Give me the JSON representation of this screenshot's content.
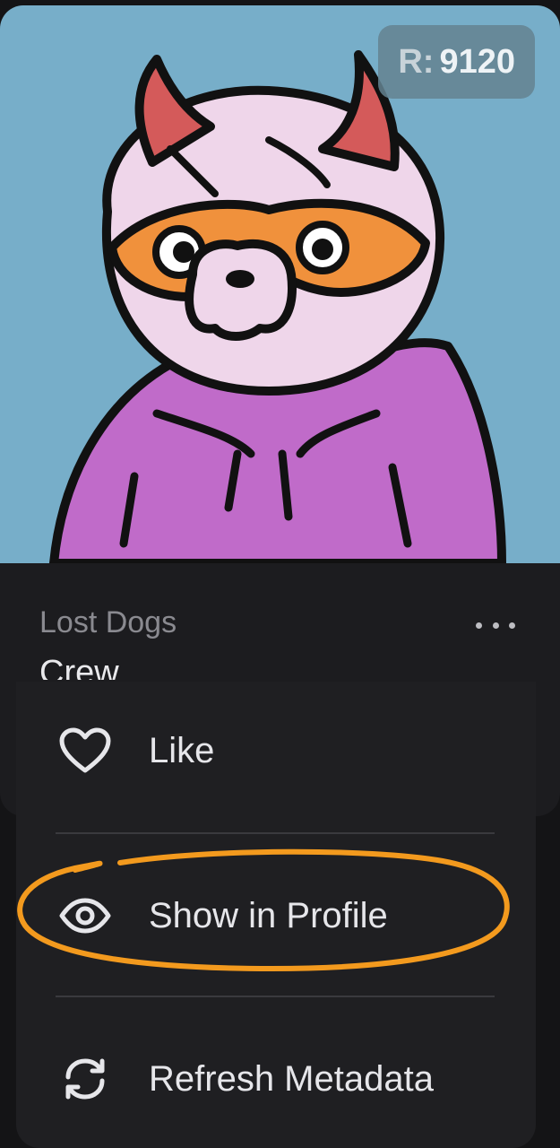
{
  "nft": {
    "rarity_prefix": "R:",
    "rarity_value": "9120",
    "collection": "Lost Dogs",
    "token_name": "Crew"
  },
  "menu": {
    "items": [
      {
        "label": "Like",
        "icon": "heart-icon"
      },
      {
        "label": "Show in Profile",
        "icon": "eye-icon"
      },
      {
        "label": "Refresh Metadata",
        "icon": "refresh-icon"
      }
    ]
  },
  "colors": {
    "image_background": "#77aec9",
    "highlight": "#f39a1e",
    "hoodie": "#c06bc9",
    "horns": "#d45a5a",
    "mask": "#f0913c"
  }
}
